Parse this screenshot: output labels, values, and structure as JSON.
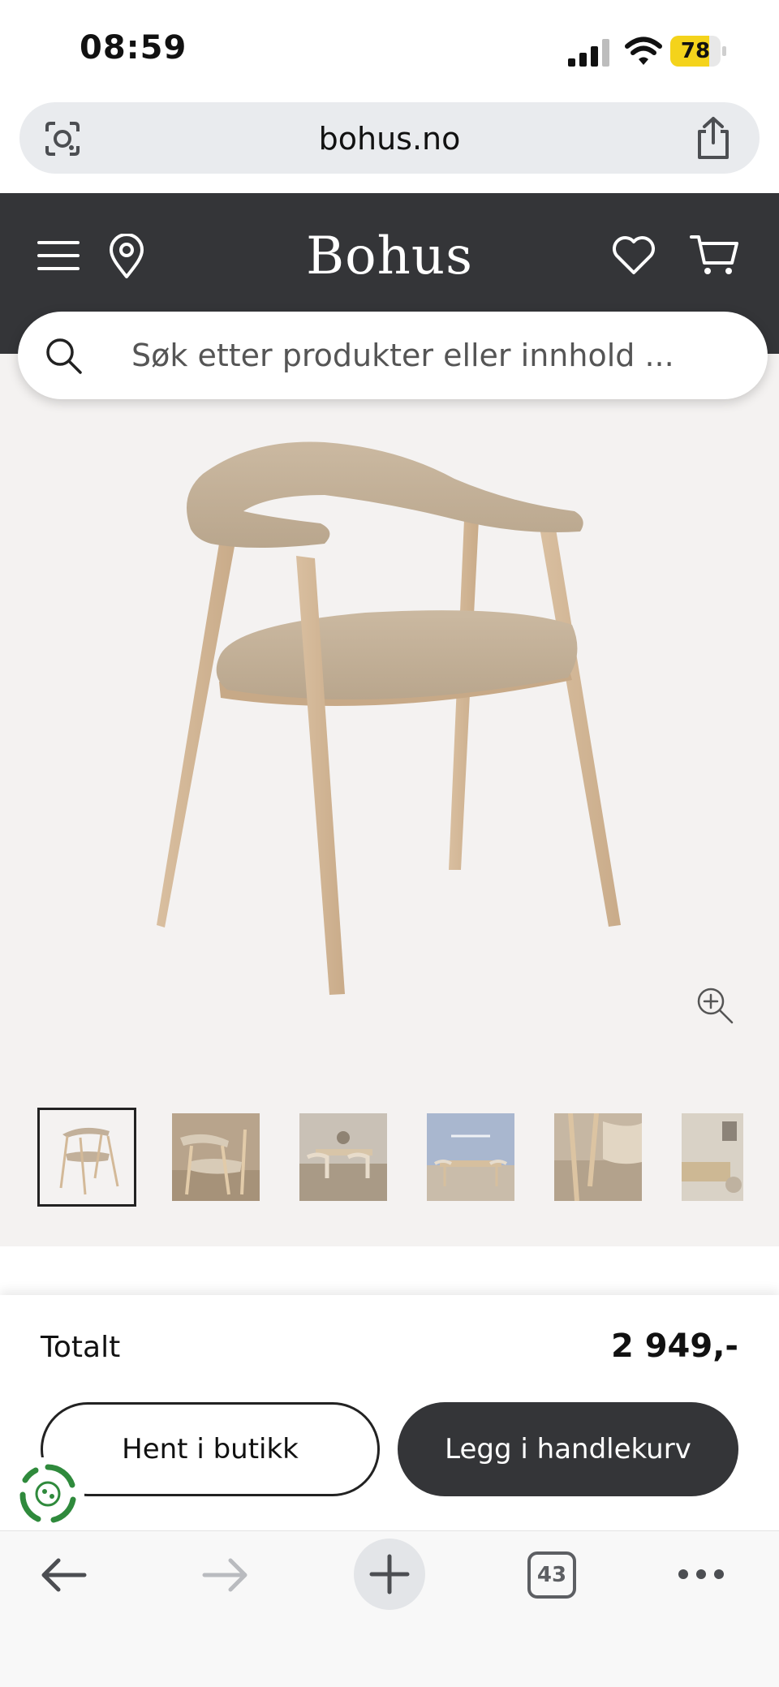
{
  "status": {
    "time": "08:59",
    "battery_level": "78",
    "battery_fraction": 0.78
  },
  "browser": {
    "url": "bohus.no",
    "tabs_count": "43"
  },
  "header": {
    "brand": "Bohus"
  },
  "search": {
    "placeholder": "Søk etter produkter eller innhold ..."
  },
  "thumbnails": [
    {
      "name": "thumb-chair-front"
    },
    {
      "name": "thumb-chair-closeup"
    },
    {
      "name": "thumb-dining-room"
    },
    {
      "name": "thumb-dining-table"
    },
    {
      "name": "thumb-chair-detail"
    },
    {
      "name": "thumb-living-room"
    }
  ],
  "summary": {
    "total_label": "Totalt",
    "total_price": "2 949,-"
  },
  "actions": {
    "pickup_label": "Hent i butikk",
    "add_to_cart_label": "Legg i handlekurv"
  },
  "colors": {
    "header_bg": "#343538",
    "product_bg": "#f4f2f1",
    "battery": "#f4d31b",
    "eco_green": "#2f8a3c"
  }
}
